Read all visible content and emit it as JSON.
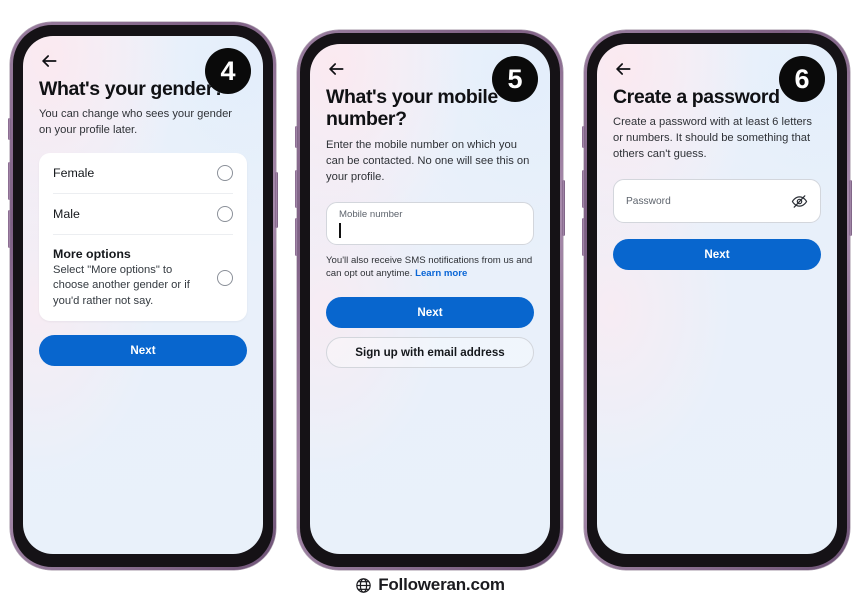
{
  "watermark": {
    "text": "Followeran.com",
    "icon": "globe-icon"
  },
  "icons": {
    "back": "back-arrow-icon",
    "eye_off": "eye-off-icon"
  },
  "screens": [
    {
      "step_badge": "4",
      "title": "What's your gender?",
      "subtitle": "You can change who sees your gender on your profile later.",
      "options": [
        {
          "label": "Female",
          "description": ""
        },
        {
          "label": "Male",
          "description": ""
        },
        {
          "label": "More options",
          "description": "Select \"More options\" to choose another gender or if you'd rather not say."
        }
      ],
      "primary_button": "Next"
    },
    {
      "step_badge": "5",
      "title": "What's your mobile number?",
      "subtitle": "Enter the mobile number on which you can be contacted. No one will see this on your profile.",
      "field_label": "Mobile number",
      "field_value": "",
      "helper_text": "You'll also receive SMS notifications from us and can opt out anytime.",
      "helper_link": "Learn more",
      "primary_button": "Next",
      "secondary_button": "Sign up with email address"
    },
    {
      "step_badge": "6",
      "title": "Create a password",
      "subtitle": "Create a password with at least 6 letters or numbers. It should be something that others can't guess.",
      "field_label": "Password",
      "field_value": "",
      "primary_button": "Next"
    }
  ],
  "colors": {
    "primary_blue": "#0866ce",
    "link_blue": "#0a66d6",
    "badge_black": "#0a0a0a",
    "frame_purple": "#7d5f83",
    "bezel_black": "#151216"
  }
}
